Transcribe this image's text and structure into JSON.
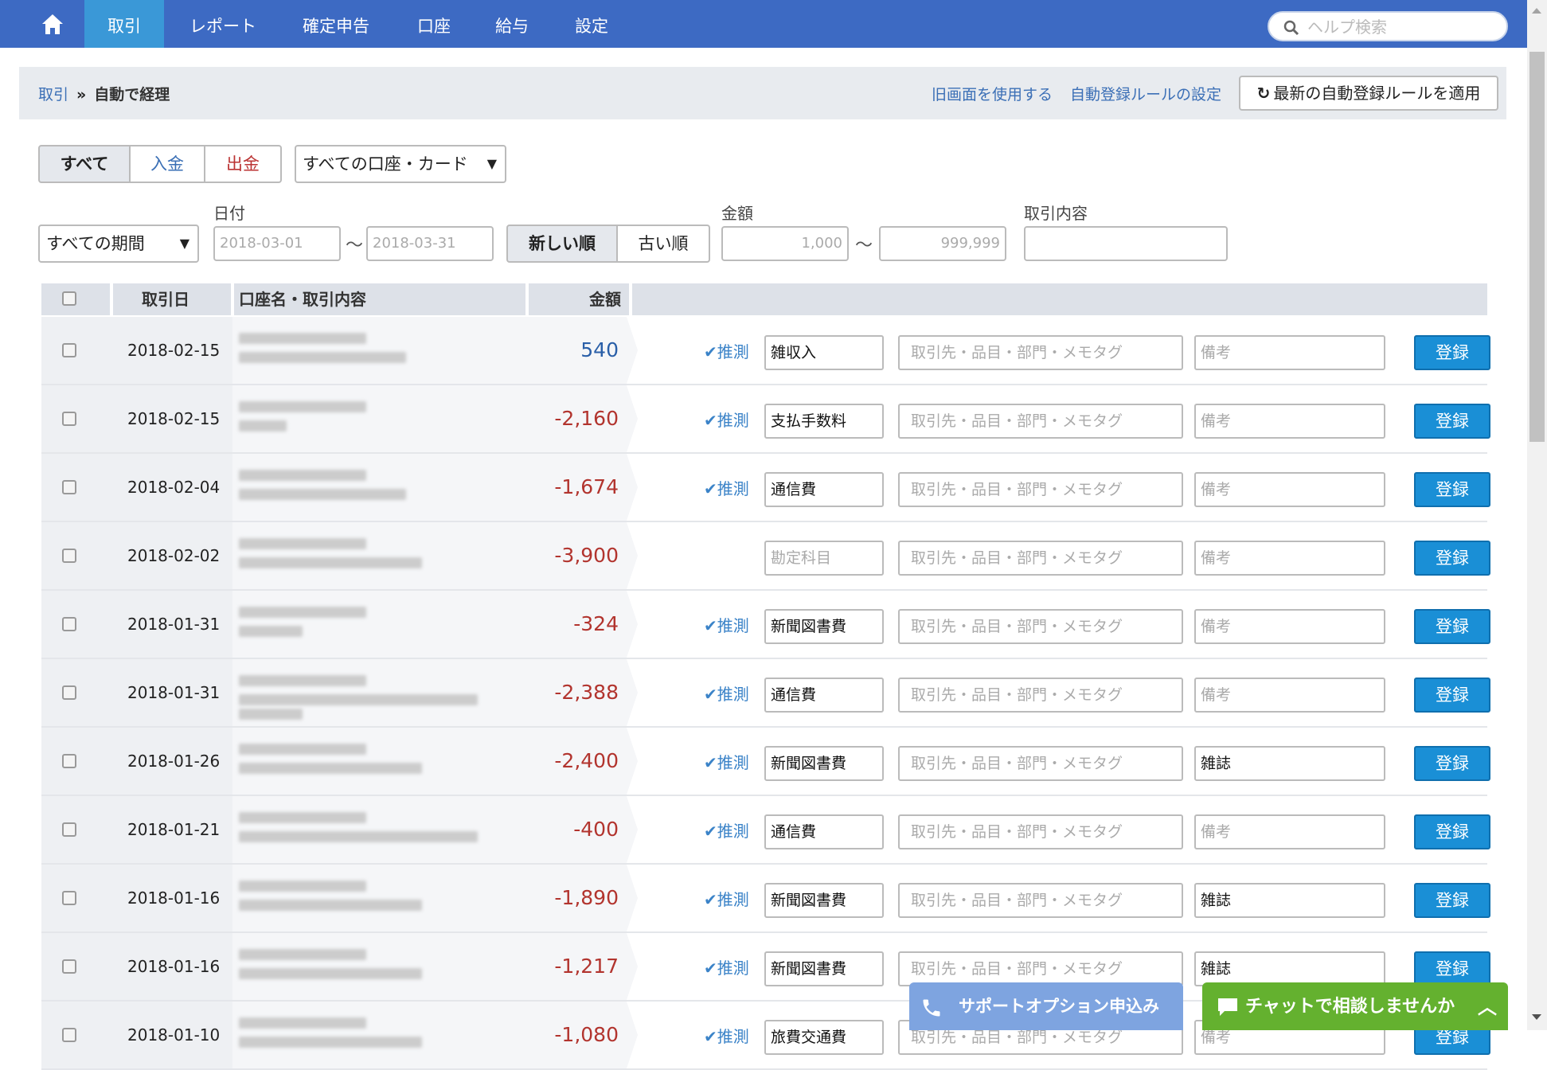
{
  "nav": {
    "items": [
      {
        "label": "取引",
        "active": true
      },
      {
        "label": "レポート"
      },
      {
        "label": "確定申告"
      },
      {
        "label": "口座"
      },
      {
        "label": "給与"
      },
      {
        "label": "設定"
      }
    ],
    "help_placeholder": "ヘルプ検索"
  },
  "breadcrumb": {
    "parent": "取引",
    "sep": "»",
    "current": "自動で経理"
  },
  "header_links": {
    "old_screen": "旧画面を使用する",
    "rule_settings": "自動登録ルールの設定",
    "apply_rules": "最新の自動登録ルールを適用"
  },
  "filters": {
    "type_all": "すべて",
    "type_in": "入金",
    "type_out": "出金",
    "account": "すべての口座・カード",
    "period": "すべての期間",
    "date_label": "日付",
    "date_from": "2018-03-01",
    "date_to": "2018-03-31",
    "tilde": "〜",
    "sort_new": "新しい順",
    "sort_old": "古い順",
    "amount_label": "金額",
    "amount_min": "1,000",
    "amount_max": "999,999",
    "desc_label": "取引内容",
    "desc_value": ""
  },
  "table": {
    "headers": {
      "date": "取引日",
      "account": "口座名・取引内容",
      "amount": "金額"
    },
    "guess_label": "✔推測",
    "partner_placeholder": "取引先・品目・部門・メモタグ",
    "note_placeholder": "備考",
    "category_placeholder": "勘定科目",
    "register_label": "登録",
    "rows": [
      {
        "date": "2018-02-15",
        "amount": "540",
        "sign": "pos",
        "guess": true,
        "category": "雑収入",
        "note": ""
      },
      {
        "date": "2018-02-15",
        "amount": "-2,160",
        "sign": "neg",
        "guess": true,
        "category": "支払手数料",
        "note": ""
      },
      {
        "date": "2018-02-04",
        "amount": "-1,674",
        "sign": "neg",
        "guess": true,
        "category": "通信費",
        "note": ""
      },
      {
        "date": "2018-02-02",
        "amount": "-3,900",
        "sign": "neg",
        "guess": false,
        "category": "",
        "note": ""
      },
      {
        "date": "2018-01-31",
        "amount": "-324",
        "sign": "neg",
        "guess": true,
        "category": "新聞図書費",
        "note": ""
      },
      {
        "date": "2018-01-31",
        "amount": "-2,388",
        "sign": "neg",
        "guess": true,
        "category": "通信費",
        "note": ""
      },
      {
        "date": "2018-01-26",
        "amount": "-2,400",
        "sign": "neg",
        "guess": true,
        "category": "新聞図書費",
        "note": "雑誌"
      },
      {
        "date": "2018-01-21",
        "amount": "-400",
        "sign": "neg",
        "guess": true,
        "category": "通信費",
        "note": ""
      },
      {
        "date": "2018-01-16",
        "amount": "-1,890",
        "sign": "neg",
        "guess": true,
        "category": "新聞図書費",
        "note": "雑誌"
      },
      {
        "date": "2018-01-16",
        "amount": "-1,217",
        "sign": "neg",
        "guess": true,
        "category": "新聞図書費",
        "note": "雑誌"
      },
      {
        "date": "2018-01-10",
        "amount": "-1,080",
        "sign": "neg",
        "guess": true,
        "category": "旅費交通費",
        "note": ""
      }
    ]
  },
  "floating": {
    "support": "サポートオプション申込み",
    "chat": "チャットで相談しませんか"
  },
  "colors": {
    "nav": "#3d6ac3",
    "nav_active": "#3a98d7",
    "register": "#1a8fd6",
    "positive": "#2a5fa8",
    "negative": "#b2342e",
    "chat": "#64b12f",
    "support": "#7ea4e0"
  }
}
